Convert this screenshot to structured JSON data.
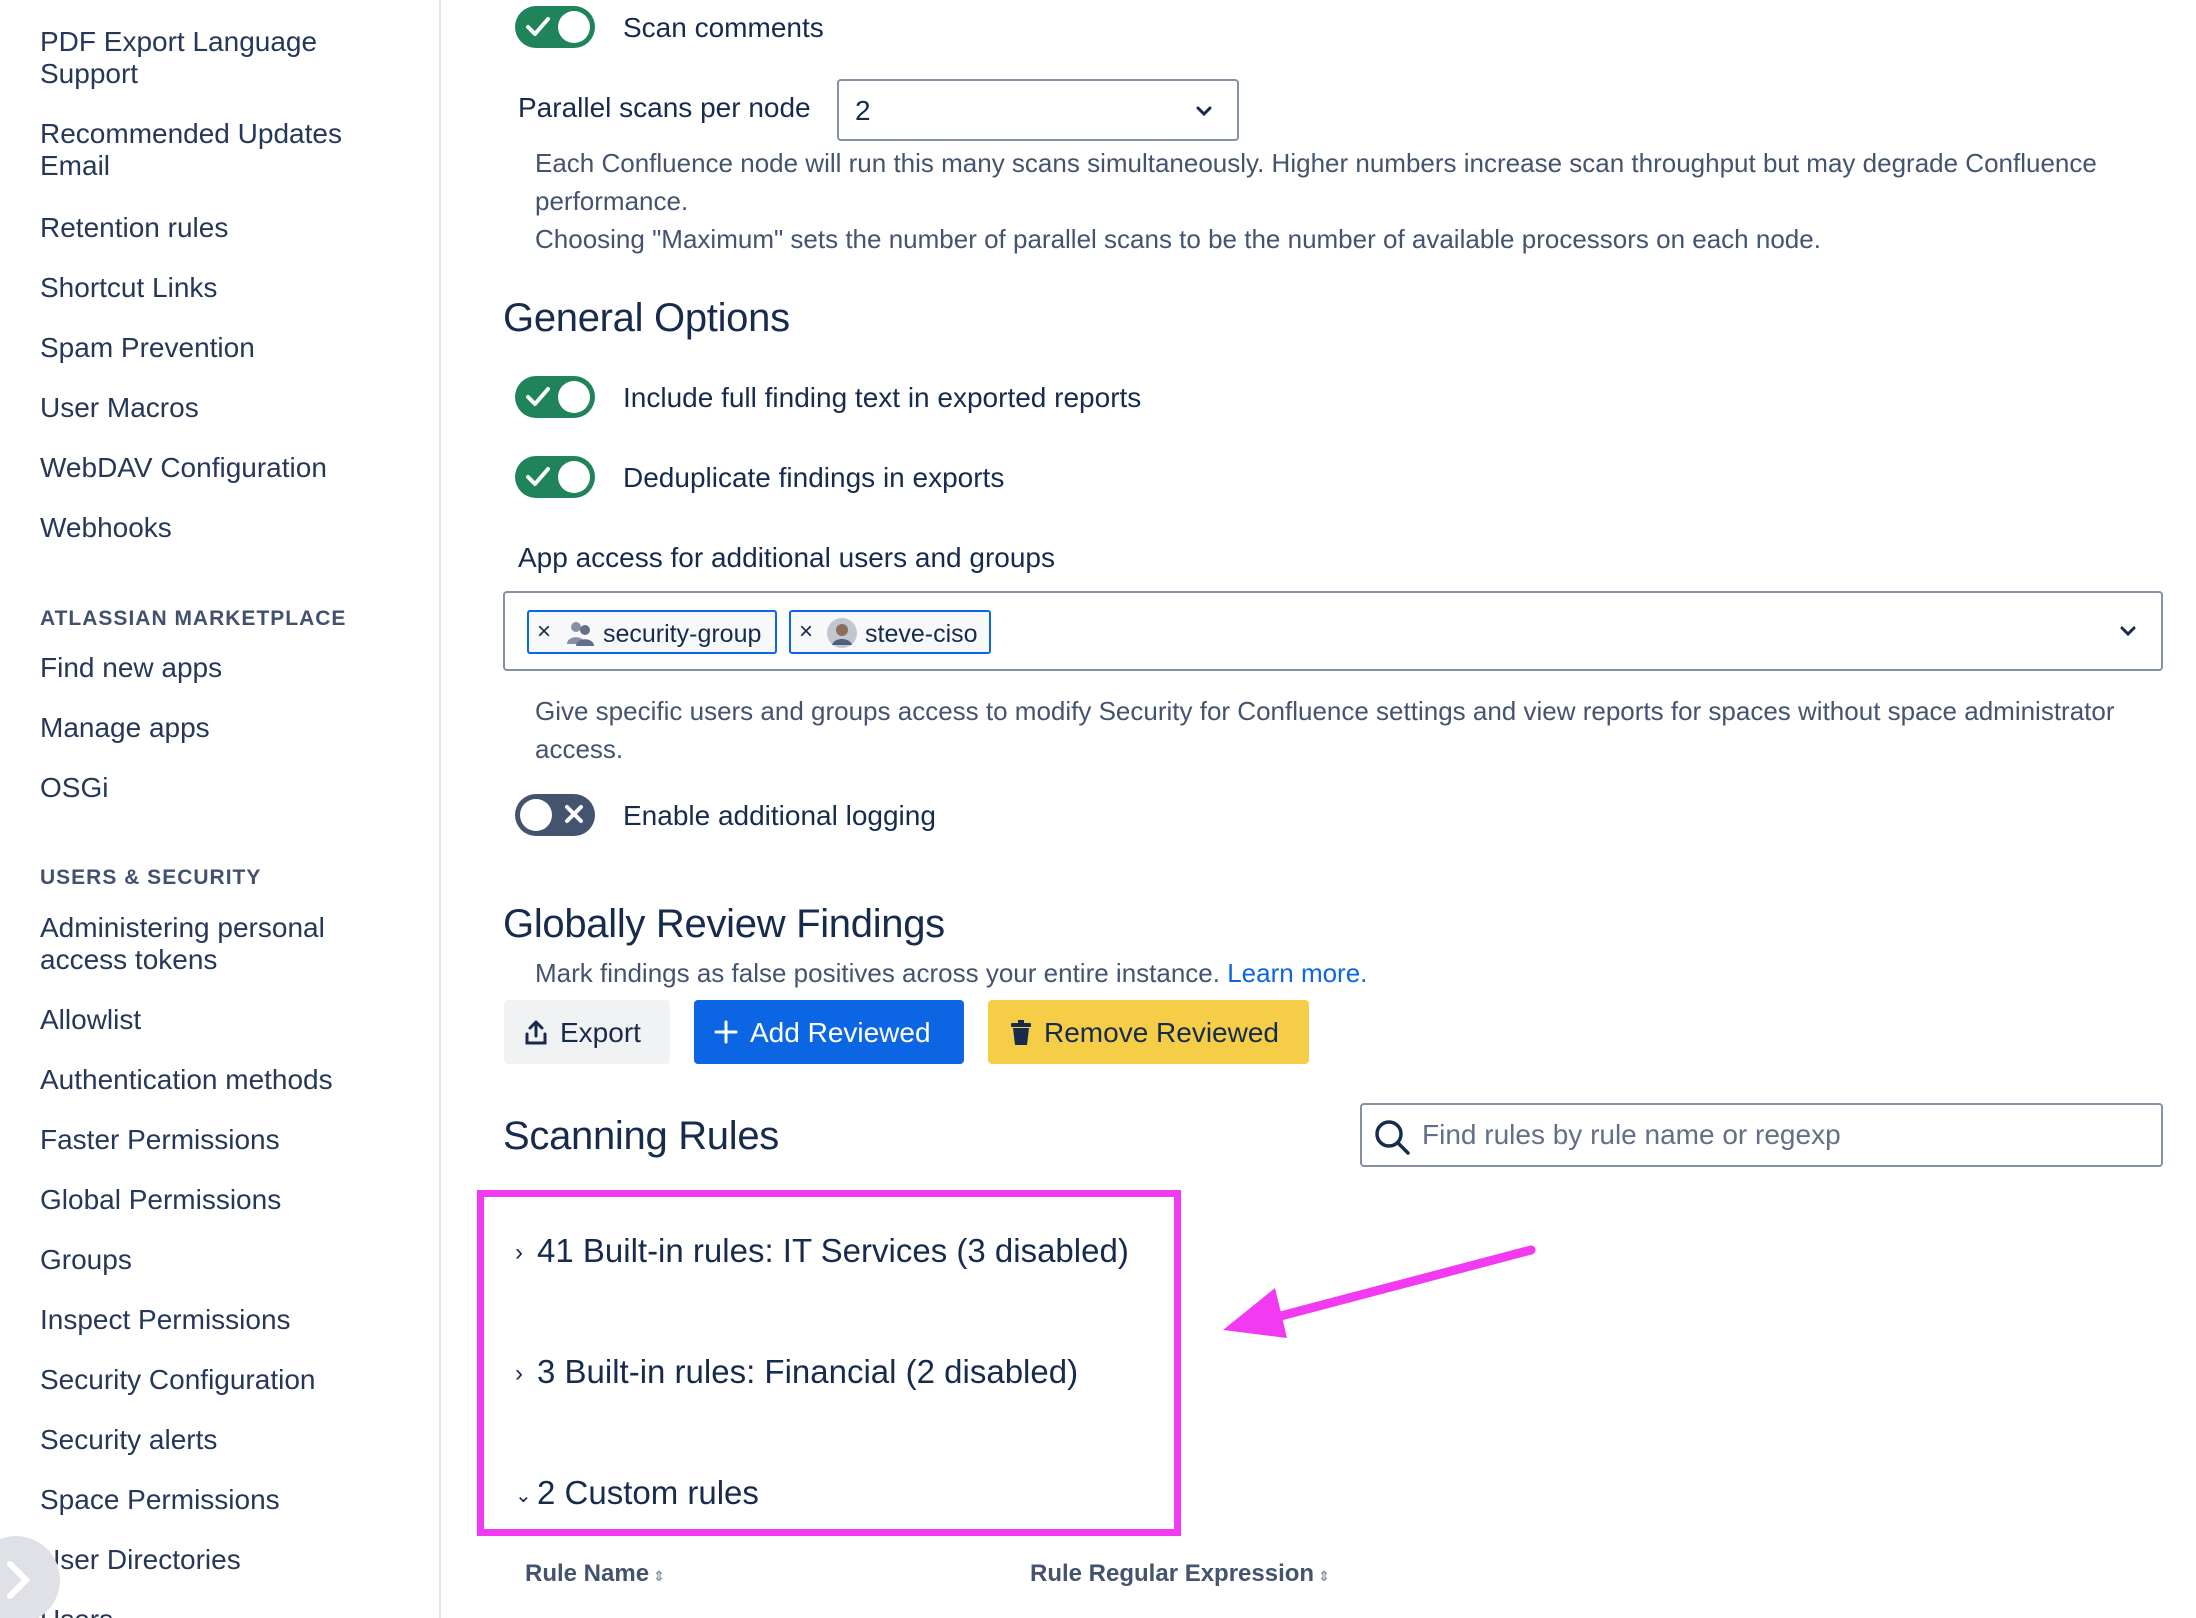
{
  "sidebar": {
    "items_top": [
      {
        "label": "PDF Export Language Support"
      },
      {
        "label": "Recommended Updates Email"
      },
      {
        "label": "Retention rules"
      },
      {
        "label": "Shortcut Links"
      },
      {
        "label": "Spam Prevention"
      },
      {
        "label": "User Macros"
      },
      {
        "label": "WebDAV Configuration"
      },
      {
        "label": "Webhooks"
      }
    ],
    "marketplace_heading": "ATLASSIAN MARKETPLACE",
    "marketplace_items": [
      {
        "label": "Find new apps"
      },
      {
        "label": "Manage apps"
      },
      {
        "label": "OSGi"
      }
    ],
    "security_heading": "USERS & SECURITY",
    "security_items": [
      {
        "label": "Administering personal access tokens"
      },
      {
        "label": "Allowlist"
      },
      {
        "label": "Authentication methods"
      },
      {
        "label": "Faster Permissions"
      },
      {
        "label": "Global Permissions"
      },
      {
        "label": "Groups"
      },
      {
        "label": "Inspect Permissions"
      },
      {
        "label": "Security Configuration"
      },
      {
        "label": "Security alerts"
      },
      {
        "label": "Space Permissions"
      },
      {
        "label": "User Directories"
      },
      {
        "label": "Users"
      }
    ]
  },
  "scan": {
    "scan_comments_label": "Scan comments",
    "scan_comments_on": true,
    "parallel_label": "Parallel scans per node",
    "parallel_value": "2",
    "parallel_help_1": "Each Confluence node will run this many scans simultaneously. Higher numbers increase scan throughput but may degrade Confluence performance.",
    "parallel_help_2": "Choosing \"Maximum\" sets the number of parallel scans to be the number of available processors on each node."
  },
  "general": {
    "heading": "General Options",
    "full_text_label": "Include full finding text in exported reports",
    "full_text_on": true,
    "dedupe_label": "Deduplicate findings in exports",
    "dedupe_on": true,
    "access_label": "App access for additional users and groups",
    "access_chips": [
      {
        "label": "security-group",
        "icon": "group-icon"
      },
      {
        "label": "steve-ciso",
        "icon": "user-avatar"
      }
    ],
    "access_help": "Give specific users and groups access to modify Security for Confluence settings and view reports for spaces without space administrator access.",
    "logging_label": "Enable additional logging",
    "logging_on": false
  },
  "review": {
    "heading": "Globally Review Findings",
    "help": "Mark findings as false positives across your entire instance.",
    "learn_more": "Learn more.",
    "export_label": "Export",
    "add_label": "Add Reviewed",
    "remove_label": "Remove Reviewed"
  },
  "rules": {
    "heading": "Scanning Rules",
    "search_placeholder": "Find rules by rule name or regexp",
    "groups": [
      {
        "label": "41 Built-in rules: IT Services (3 disabled)",
        "expanded": false
      },
      {
        "label": "3 Built-in rules: Financial (2 disabled)",
        "expanded": false
      },
      {
        "label": "2 Custom rules",
        "expanded": true
      }
    ],
    "columns": [
      "Rule Name",
      "Rule Regular Expression"
    ]
  },
  "colors": {
    "toggle_on": "#1f845a",
    "toggle_off": "#44546f",
    "primary_button": "#0c66e4",
    "warning_button": "#f5cd47",
    "highlight": "#f13af1"
  }
}
